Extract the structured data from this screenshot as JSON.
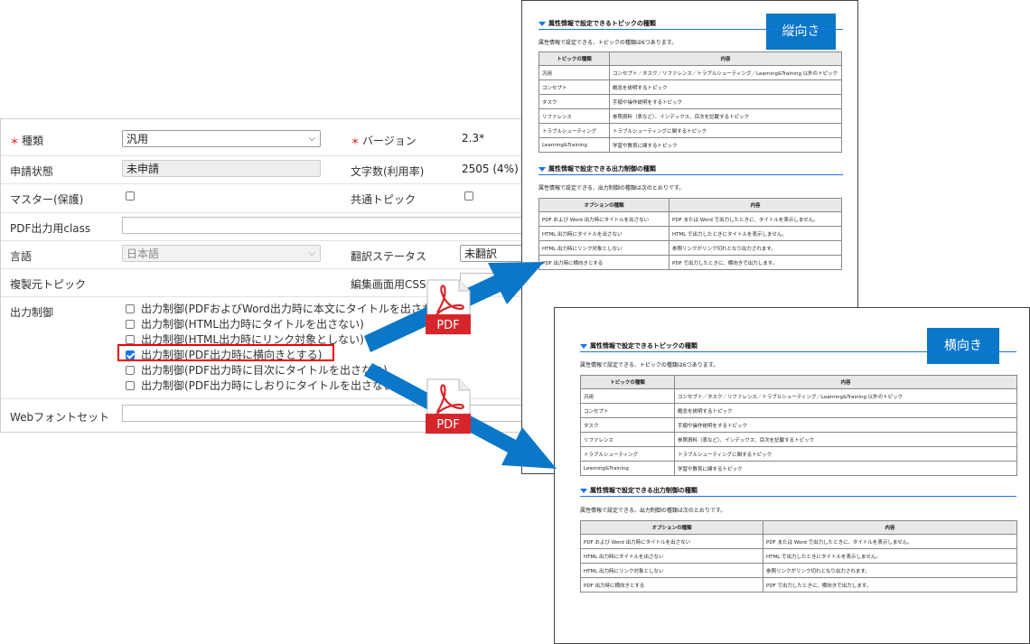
{
  "form": {
    "kind_label": "種類",
    "kind_value": "汎用",
    "version_label": "バージョン",
    "version_value": "2.3*",
    "status_label": "申請状態",
    "status_value": "未申請",
    "charcount_label": "文字数(利用率)",
    "charcount_value": "2505 (4%)",
    "master_label": "マスター(保護)",
    "common_label": "共通トピック",
    "pdfclass_label": "PDF出力用class",
    "lang_label": "言語",
    "lang_value": "日本語",
    "trans_label": "翻訳ステータス",
    "trans_value": "未翻訳",
    "copysrc_label": "複製元トピック",
    "editcss_label": "編集画面用CSS",
    "output_label": "出力制御",
    "options": [
      {
        "label": "出力制御(PDFおよびWord出力時に本文にタイトルを出さない)",
        "checked": false
      },
      {
        "label": "出力制御(HTML出力時にタイトルを出さない)",
        "checked": false
      },
      {
        "label": "出力制御(HTML出力時にリンク対象としない)",
        "checked": false
      },
      {
        "label": "出力制御(PDF出力時に横向きとする)",
        "checked": true
      },
      {
        "label": "出力制御(PDF出力時に目次にタイトルを出さない)",
        "checked": false
      },
      {
        "label": "出力制御(PDF出力時にしおりにタイトルを出さない)",
        "checked": false
      }
    ],
    "webfont_label": "Webフォントセット"
  },
  "pdf_icon_label": "PDF",
  "docs": {
    "portrait_tag": "縦向き",
    "landscape_tag": "横向き",
    "sec1_title": "属性情報で設定できるトピックの種類",
    "sec1_intro": "属性情報で設定できる、トピックの種類は6つあります。",
    "sec1_headers": [
      "トピックの種類",
      "内容"
    ],
    "sec1_rows": [
      [
        "汎用",
        "コンセプト／タスク／リファレンス／トラブルシューティング／Learning&Training 以外のトピック"
      ],
      [
        "コンセプト",
        "概念を説明するトピック"
      ],
      [
        "タスク",
        "手順や操作説明をするトピック"
      ],
      [
        "リファレンス",
        "参照資料（表など）、インデックス、目次を記載するトピック"
      ],
      [
        "トラブルシューティング",
        "トラブルシューティングに関するトピック"
      ],
      [
        "Learning&Training",
        "学習や教育に関するトピック"
      ]
    ],
    "sec2_title": "属性情報で設定できる出力制御の種類",
    "sec2_intro": "属性情報で設定できる、出力制御の種類は次のとおりです。",
    "sec2_headers": [
      "オプションの種類",
      "内容"
    ],
    "sec2_rows": [
      [
        "PDF および Word 出力時にタイトルを出さない",
        "PDF または Word で出力したときに、タイトルを表示しません。"
      ],
      [
        "HTML 出力時にタイトルを出さない",
        "HTML で出力したときにタイトルを表示しません。"
      ],
      [
        "HTML 出力時にリンク対象としない",
        "参照リンクがリンク切れとなり出力されます。"
      ],
      [
        "PDF 出力時に横向きとする",
        "PDF で出力したときに、横向きで出力します。"
      ]
    ]
  },
  "colors": {
    "accent": "#0b77c9",
    "highlight": "#e00000",
    "pdf_red": "#d7262b"
  }
}
